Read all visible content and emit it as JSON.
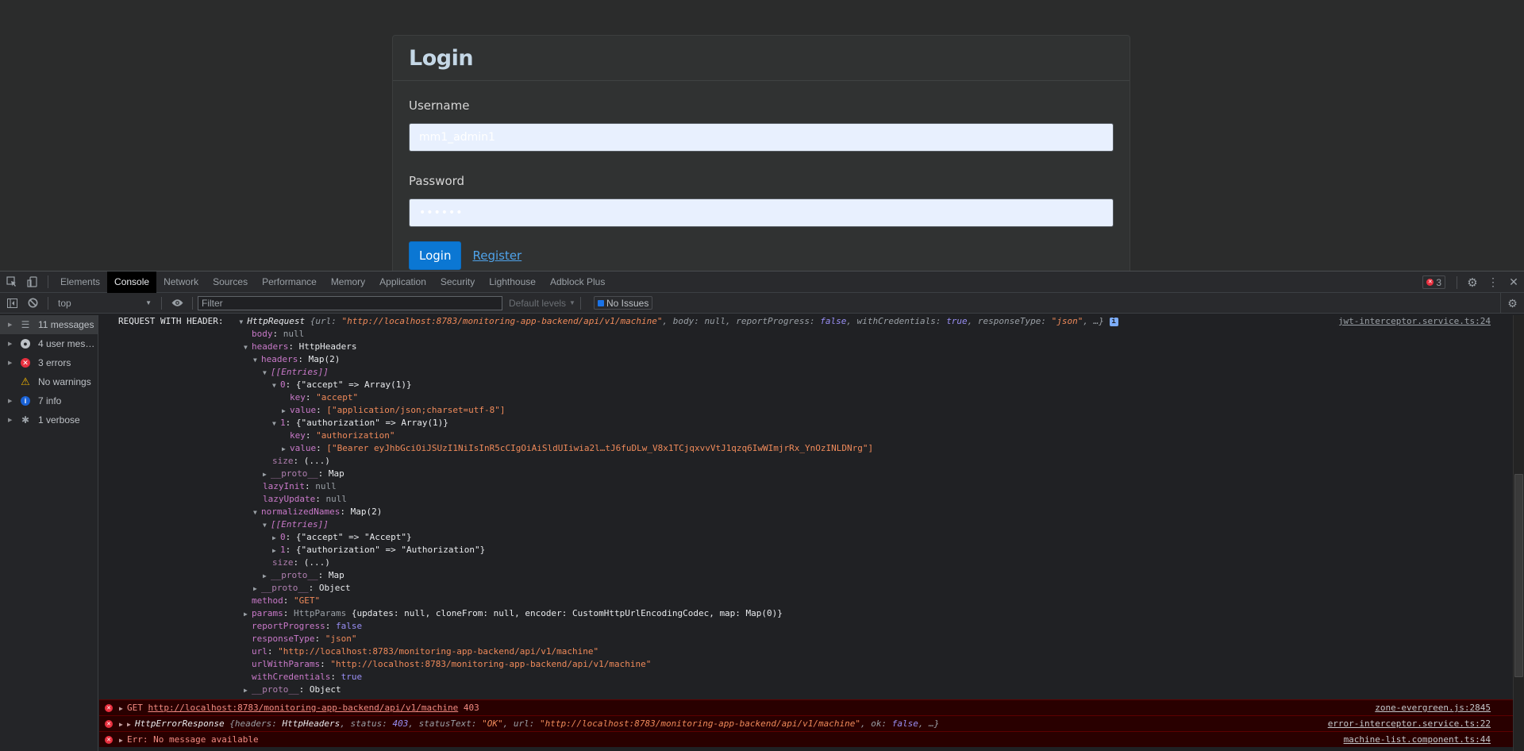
{
  "page": {
    "card_title": "Login",
    "username_label": "Username",
    "username_value": "mm1_admin1",
    "password_label": "Password",
    "password_value": "••••••",
    "login_button": "Login",
    "register_link": "Register"
  },
  "devtools": {
    "tabs": [
      "Elements",
      "Console",
      "Network",
      "Sources",
      "Performance",
      "Memory",
      "Application",
      "Security",
      "Lighthouse",
      "Adblock Plus"
    ],
    "active_tab": "Console",
    "error_count": "3",
    "toolbar": {
      "context": "top",
      "filter_placeholder": "Filter",
      "levels": "Default levels",
      "issues": "No Issues"
    },
    "sidebar": [
      {
        "label": "11 messages",
        "icon": "list-icon",
        "selected": true
      },
      {
        "label": "4 user mes…",
        "icon": "user-icon"
      },
      {
        "label": "3 errors",
        "icon": "error-icon"
      },
      {
        "label": "No warnings",
        "icon": "warning-icon"
      },
      {
        "label": "7 info",
        "icon": "info-icon"
      },
      {
        "label": "1 verbose",
        "icon": "bug-icon"
      }
    ],
    "console": {
      "log_prefix": "REQUEST WITH HEADER:",
      "log_source": "jwt-interceptor.service.ts:24",
      "summary_type": "HttpRequest",
      "summary_url": "\"http://localhost:8783/monitoring-app-backend/api/v1/machine\"",
      "lines": {
        "body": "null",
        "headers_type": "HttpHeaders",
        "headers_map": "Map(2)",
        "entries": "[[Entries]]",
        "e0": "{\"accept\" => Array(1)}",
        "e0_key": "\"accept\"",
        "e0_value": "[\"application/json;charset=utf-8\"]",
        "e1": "{\"authorization\" => Array(1)}",
        "e1_key": "\"authorization\"",
        "e1_value": "[\"Bearer eyJhbGciOiJSUzI1NiIsInR5cCIgOiAiSldUIiwia2l…tJ6fuDLw_V8x1TCjqxvvVtJ1qzq6IwWImjrRx_YnOzINLDNrg\"]",
        "size": "(...)",
        "proto_map": "Map",
        "lazyInit": "null",
        "lazyUpdate": "null",
        "normalized_map": "Map(2)",
        "n0": "{\"accept\" => \"Accept\"}",
        "n1": "{\"authorization\" => \"Authorization\"}",
        "proto_object": "Object",
        "method": "\"GET\"",
        "params": "{updates: null, cloneFrom: null, encoder: CustomHttpUrlEncodingCodec, map: Map(0)}",
        "params_type": "HttpParams",
        "reportProgress": "false",
        "responseType": "\"json\"",
        "url": "\"http://localhost:8783/monitoring-app-backend/api/v1/machine\"",
        "urlWithParams": "\"http://localhost:8783/monitoring-app-backend/api/v1/machine\"",
        "withCredentials": "true"
      },
      "errors": [
        {
          "method": "GET",
          "url": "http://localhost:8783/monitoring-app-backend/api/v1/machine",
          "status": "403",
          "source": "zone-evergreen.js:2845"
        },
        {
          "type": "HttpErrorResponse",
          "status": "403",
          "statusText": "\"OK\"",
          "url": "\"http://localhost:8783/monitoring-app-backend/api/v1/machine\"",
          "ok": "false",
          "source": "error-interceptor.service.ts:22"
        },
        {
          "text": "Err: No message available",
          "source": "machine-list.component.ts:44"
        }
      ]
    }
  }
}
